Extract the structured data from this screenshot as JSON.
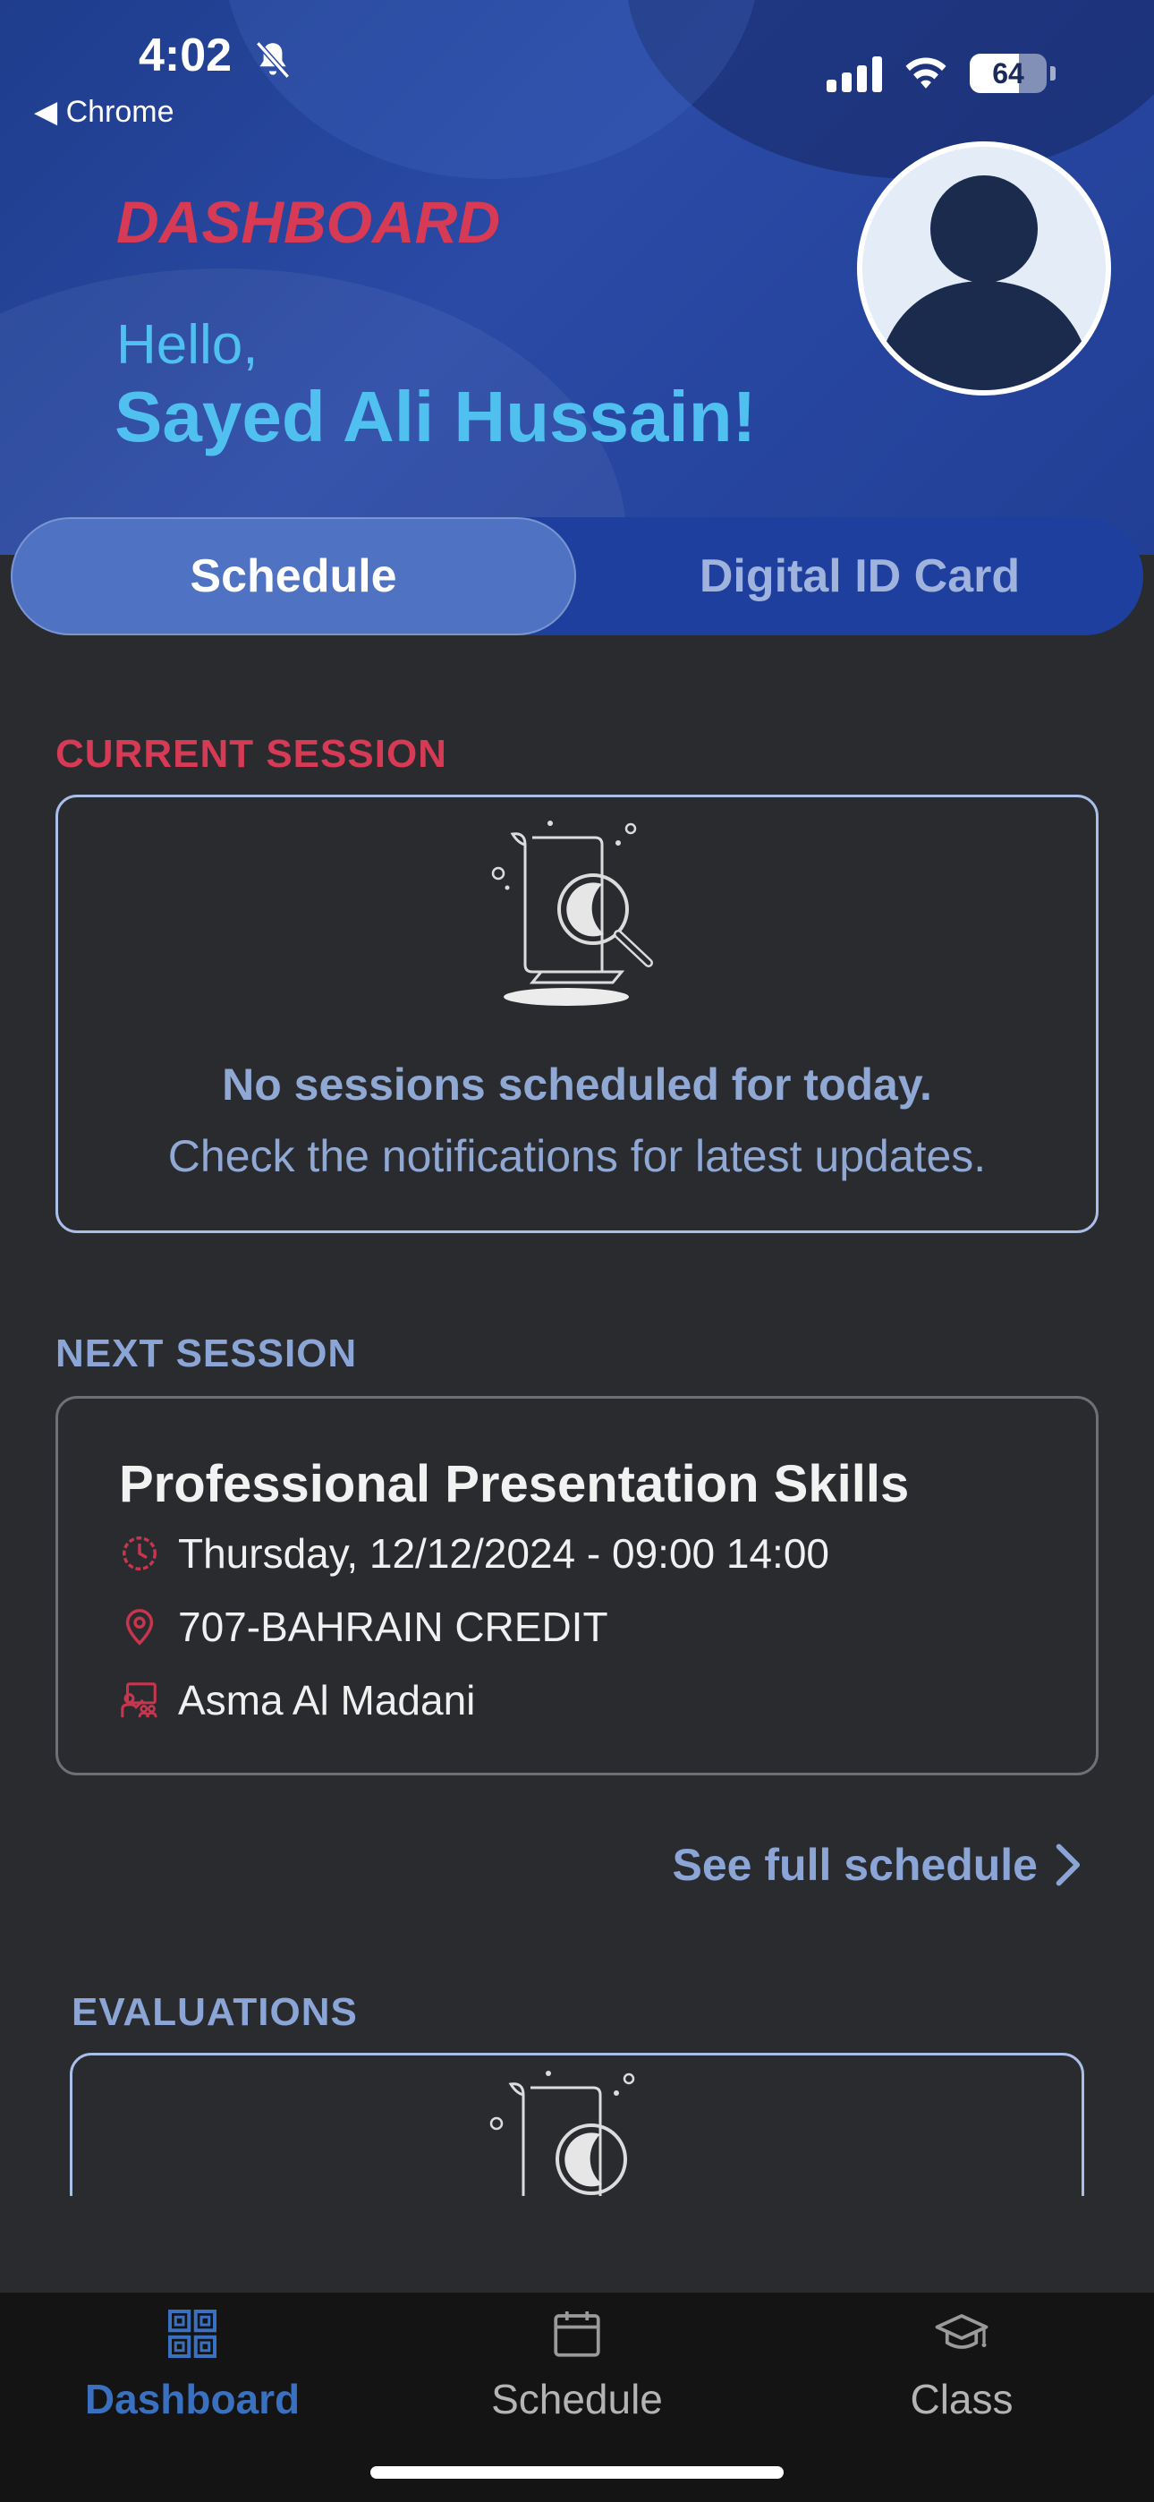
{
  "status_bar": {
    "time": "4:02",
    "back_app": "◀ Chrome",
    "battery": "64",
    "battery_level": 0.64
  },
  "header": {
    "title": "DASHBOARD",
    "greeting": "Hello,",
    "user_name": "Sayed Ali Hussain!"
  },
  "tabs": [
    {
      "label": "Schedule",
      "active": true
    },
    {
      "label": "Digital ID Card",
      "active": false
    }
  ],
  "current_session": {
    "label": "CURRENT SESSION",
    "empty_title": "No sessions scheduled for today.",
    "empty_text": "Check the notifications for latest updates."
  },
  "next_session": {
    "label": "NEXT SESSION",
    "title": "Professional Presentation Skills",
    "datetime": "Thursday, 12/12/2024 - 09:00 14:00",
    "location": "707-BAHRAIN CREDIT",
    "instructor": "Asma Al Madani"
  },
  "see_full_schedule": "See full schedule",
  "evaluations": {
    "label": "EVALUATIONS"
  },
  "bottom_nav": [
    {
      "label": "Dashboard",
      "icon": "dashboard-grid-icon",
      "active": true
    },
    {
      "label": "Schedule",
      "icon": "calendar-icon",
      "active": false
    },
    {
      "label": "Class",
      "icon": "graduation-cap-icon",
      "active": false
    }
  ],
  "colors": {
    "accent_red": "#d63a55",
    "accent_cyan": "#4fc0f0",
    "muted_blue": "#90a8d4",
    "nav_active": "#3a70c0",
    "background": "#2a2b2f"
  }
}
